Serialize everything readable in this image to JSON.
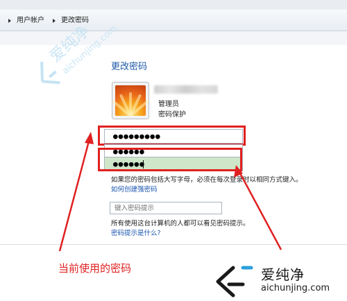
{
  "breadcrumb": {
    "items": [
      "用户帐户",
      "更改密码"
    ]
  },
  "page": {
    "title": "更改密码"
  },
  "user": {
    "role": "管理员",
    "status": "密码保护"
  },
  "fields": {
    "current_password": "●●●●●●●●●",
    "new_password": "●●●●●●",
    "confirm_password": "●●●●●●",
    "hint_placeholder": "键入密码提示"
  },
  "messages": {
    "case_note": "如果您的密码包括大写字母，必须在每次登录时以相同方式键入。",
    "strong_link": "如何创建强密码",
    "visibility_note": "所有使用这台计算机的人都可以看见密码提示。",
    "hint_link": "密码提示是什么?"
  },
  "annotation": {
    "text": "当前使用的密码",
    "color": "#e02020"
  },
  "watermark": {
    "name": "爱纯净",
    "url": "aichunjing.com"
  },
  "colors": {
    "title": "#1e5aa8",
    "link": "#1c56b0",
    "highlight": "#e02020",
    "active_field": "#cfe6c9"
  }
}
